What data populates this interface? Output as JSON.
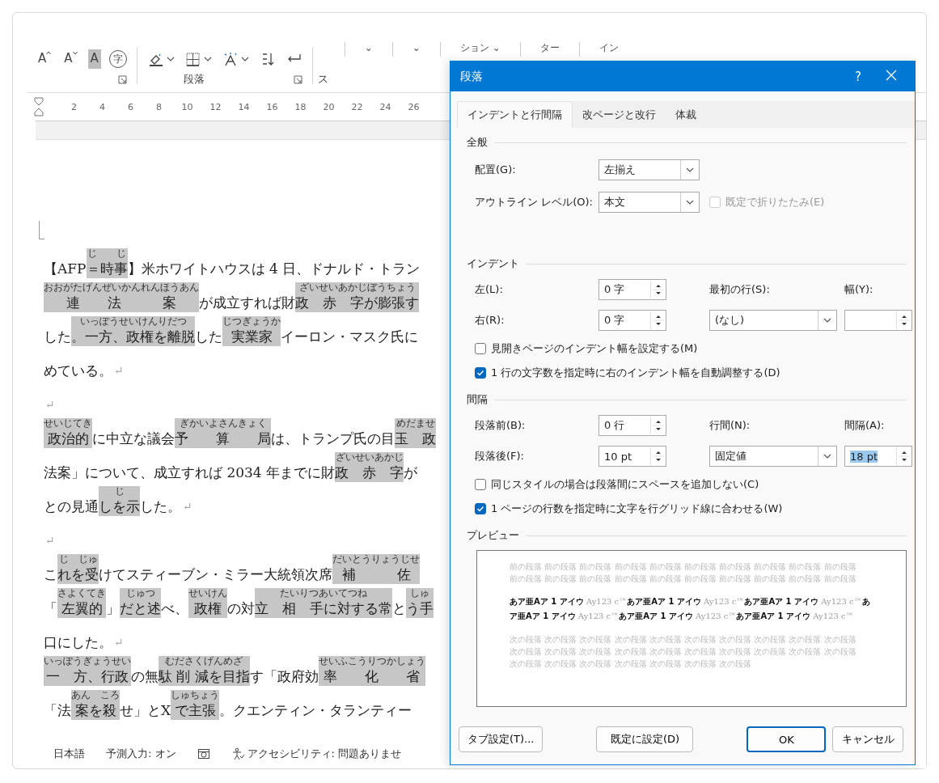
{
  "ribbon": {
    "font_tools": [
      {
        "kind": "grow",
        "glyph": "A"
      },
      {
        "kind": "shrink",
        "glyph": "A"
      },
      {
        "kind": "shade",
        "glyph": "A"
      },
      {
        "kind": "enclose",
        "glyph": "字"
      }
    ],
    "paragraph_tools": [
      {
        "kind": "shading",
        "dropdown": true
      },
      {
        "kind": "borders",
        "dropdown": true
      },
      {
        "kind": "text-effect",
        "dropdown": true
      },
      {
        "kind": "sort",
        "dropdown": false
      },
      {
        "kind": "line-break",
        "dropdown": false
      }
    ],
    "group_label": "段落",
    "next_group_label": "ス",
    "top_right_items": [
      "⌄",
      "⌄",
      "ション ⌄",
      "ター",
      "イン"
    ]
  },
  "ruler": {
    "ticks": [
      "2",
      "4",
      "6",
      "8",
      "10",
      "12",
      "14",
      "16",
      "18",
      "20",
      "22",
      "24",
      "26"
    ]
  },
  "document": {
    "lines": [
      [
        {
          "text": "【AFP"
        },
        {
          "text": "＝時事",
          "highlight": true,
          "ruby": "じ　　じ"
        },
        {
          "text": "】米ホワイトハウスは 4 日、ドナルド・トラン"
        }
      ],
      [
        {
          "text": "連　　法　　　案",
          "highlight": true,
          "ruby": "おおがたげんぜいかんれんほうあん"
        },
        {
          "text": "が成立すれば財"
        },
        {
          "text": "政　赤　字が膨張す",
          "highlight": true,
          "ruby": "ざいせいあかじぼうちょう"
        }
      ],
      [
        {
          "text": "した"
        },
        {
          "text": "。一方、政権を離脱",
          "highlight": true,
          "ruby": "いっぽうせいけんりだつ"
        },
        {
          "text": "した"
        },
        {
          "text": "実業家",
          "highlight": true,
          "ruby": "じつぎょうか"
        },
        {
          "text": "イーロン・マスク氏に"
        }
      ],
      [
        {
          "text": "めている。"
        },
        {
          "mark": "↵"
        }
      ],
      [
        {
          "mark": "↵"
        }
      ],
      [
        {
          "text": "政治的",
          "highlight": true,
          "ruby": "せいじてき"
        },
        {
          "text": "に中立な議会"
        },
        {
          "text": "予　　算　　局",
          "highlight": true,
          "ruby": "ぎかいよさんきょく"
        },
        {
          "text": "は、トランプ氏の目"
        },
        {
          "text": "玉　政",
          "highlight": true,
          "ruby": "めだませ"
        }
      ],
      [
        {
          "text": "法案」について、成立すれば 2034 年までに財"
        },
        {
          "text": "政　赤　字",
          "highlight": true,
          "ruby": "ざいせいあかじ"
        },
        {
          "text": "が"
        }
      ],
      [
        {
          "text": "との見通"
        },
        {
          "text": "しを示",
          "highlight": true,
          "ruby": "じ"
        },
        {
          "text": "した。"
        },
        {
          "mark": "↵"
        }
      ],
      [
        {
          "mark": "↵"
        }
      ],
      [
        {
          "text": "こ"
        },
        {
          "text": "れを受",
          "highlight": true,
          "ruby": "じ　じゅ"
        },
        {
          "text": "けてスティーブン・ミラー大統領次席"
        },
        {
          "text": "補　　　佐",
          "highlight": true,
          "ruby": "だいとうりょうじせ"
        }
      ],
      [
        {
          "text": "「"
        },
        {
          "text": "左翼的",
          "highlight": true,
          "ruby": "さよくてき"
        },
        {
          "text": "」"
        },
        {
          "text": "だと述",
          "highlight": true,
          "ruby": "じゅつ"
        },
        {
          "text": "べ、"
        },
        {
          "text": "政権",
          "highlight": true,
          "ruby": "せいけん"
        },
        {
          "text": "の対"
        },
        {
          "text": "立　相　手に対する常",
          "highlight": true,
          "ruby": "たいりつあいてつね"
        },
        {
          "text": "と"
        },
        {
          "text": "う手",
          "highlight": true,
          "ruby": "しゅ"
        }
      ],
      [
        {
          "text": "口にした。"
        },
        {
          "mark": "↵"
        }
      ],
      [
        {
          "text": "一　方、行政",
          "highlight": true,
          "ruby": "いっぽうぎょうせい"
        },
        {
          "text": "の無"
        },
        {
          "text": "駄 削 減を目指",
          "highlight": true,
          "ruby": "むださくげんめざ"
        },
        {
          "text": "す「政府効"
        },
        {
          "text": "率　　化　　省",
          "highlight": true,
          "ruby": "せいふこうりつかしょう"
        }
      ],
      [
        {
          "text": "「法"
        },
        {
          "text": "案を殺",
          "highlight": true,
          "ruby": "あん　ころ"
        },
        {
          "text": "せ」とX"
        },
        {
          "text": "で主張",
          "highlight": true,
          "ruby": "しゅちょう"
        },
        {
          "text": "。クエンティン・タランティー"
        }
      ]
    ]
  },
  "status_bar": {
    "items": [
      {
        "kind": "text",
        "label": "日本語"
      },
      {
        "kind": "text",
        "label": "予測入力: オン"
      },
      {
        "kind": "macro"
      },
      {
        "kind": "accessibility",
        "label": "アクセシビリティ: 問題ありませ"
      }
    ]
  },
  "dialog": {
    "title": "段落",
    "help": "?",
    "tabs": [
      {
        "label": "インデントと行間隔",
        "selected": true
      },
      {
        "label": "改ページと改行",
        "selected": false
      },
      {
        "label": "体裁",
        "selected": false
      }
    ],
    "general": {
      "heading": "全般",
      "alignment": {
        "label": "配置(G):",
        "value": "左揃え"
      },
      "outline_level": {
        "label": "アウトライン レベル(O):",
        "value": "本文"
      },
      "collapse": {
        "label": "既定で折りたたみ(E)",
        "checked": false,
        "disabled": true
      }
    },
    "indent": {
      "heading": "インデント",
      "left": {
        "label": "左(L):",
        "value": "0 字"
      },
      "right": {
        "label": "右(R):",
        "value": "0 字"
      },
      "first_line": {
        "label": "最初の行(S):",
        "value": "(なし)"
      },
      "width": {
        "label": "幅(Y):"
      },
      "checkboxes": [
        {
          "label": "見開きページのインデント幅を設定する(M)",
          "checked": false
        },
        {
          "label": "1 行の文字数を指定時に右のインデント幅を自動調整する(D)",
          "checked": true
        }
      ]
    },
    "spacing": {
      "heading": "間隔",
      "before": {
        "label": "段落前(B):",
        "value": "0 行"
      },
      "after": {
        "label": "段落後(F):",
        "value": "10 pt"
      },
      "line_spacing": {
        "label": "行間(N):",
        "value": "固定値"
      },
      "at": {
        "label": "間隔(A):",
        "value": "18 pt",
        "selected": true
      },
      "checkboxes": [
        {
          "label": "同じスタイルの場合は段落間にスペースを追加しない(C)",
          "checked": false
        },
        {
          "label": "1 ページの行数を指定時に文字を行グリッド線に合わせる(W)",
          "checked": true
        }
      ]
    },
    "preview": {
      "heading": "プレビュー",
      "previous_lines": [
        "前の段落 前の段落 前の段落 前の段落 前の段落 前の段落 前の段落 前の段落 前の段落 前の段落",
        "前の段落 前の段落 前の段落 前の段落 前の段落 前の段落 前の段落 前の段落 前の段落 前の段落"
      ],
      "sample_lines": [
        "**あア亜Aア 1 アイウ** Ay123 c™**あア亜Aア 1 アイウ** Ay123 c™**あア亜Aア 1 アイウ** Ay123 c™**あ**",
        "**ア亜Aア 1 アイウ** Ay123 c™**あア亜Aア 1 アイウ** Ay123 c™**あア亜Aア 1 アイウ** Ay123 c™"
      ],
      "next_lines": [
        "次の段落 次の段落 次の段落 次の段落 次の段落 次の段落 次の段落 次の段落 次の段落 次の段落",
        "次の段落 次の段落 次の段落 次の段落 次の段落 次の段落 次の段落 次の段落 次の段落 次の段落",
        "次の段落 次の段落 次の段落 次の段落 次の段落 次の段落 次の段落"
      ]
    },
    "buttons": [
      {
        "label": "タブ設定(T)...",
        "kind": "plain"
      },
      {
        "label": "既定に設定(D)",
        "kind": "plain"
      },
      {
        "label": "OK",
        "kind": "default"
      },
      {
        "label": "キャンセル",
        "kind": "plain"
      }
    ]
  }
}
